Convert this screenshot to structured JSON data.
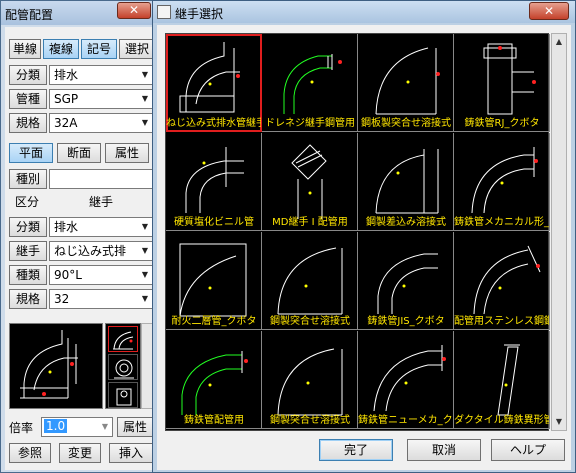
{
  "left_panel": {
    "title": "配管配置",
    "close": "✕",
    "mode_buttons": [
      "単線",
      "複線",
      "記号",
      "選択"
    ],
    "fields1": [
      {
        "label": "分類",
        "value": "排水"
      },
      {
        "label": "管種",
        "value": "SGP"
      },
      {
        "label": "規格",
        "value": "32A"
      }
    ],
    "view_buttons": [
      "平面",
      "断面",
      "属性"
    ],
    "kind_label": "種別",
    "kind_value": "",
    "section_label": "区分",
    "section_value": "継手",
    "fields2": [
      {
        "label": "分類",
        "value": "排水"
      },
      {
        "label": "継手",
        "value": "ねじ込み式排"
      },
      {
        "label": "種類",
        "value": "90°L"
      },
      {
        "label": "規格",
        "value": "32"
      }
    ],
    "scale_label": "倍率",
    "scale_value": "1.0",
    "attr_button": "属性",
    "bottom_buttons": [
      "参照",
      "変更",
      "挿入"
    ]
  },
  "dialog": {
    "title": "継手選択",
    "close": "✕",
    "items": [
      "ねじ込み式排水管継手",
      "ドレネジ継手鋼管用",
      "鋼板製突合せ溶接式",
      "鋳鉄管RJ_クボタ",
      "硬質塩化ビニル管",
      "MD継手 I 配管用",
      "鋼製差込み溶接式",
      "鋳鉄管メカニカル形_クボタ",
      "耐火二層管_クボタ",
      "鋼製突合せ溶接式",
      "鋳鉄管JIS_クボタ",
      "配管用ステンレス鋼鋼管",
      "鋳鉄管配管用",
      "鋼製突合せ溶接式",
      "鋳鉄管ニューメカ_クボタ",
      "ダクタイル鋳鉄異形管"
    ],
    "buttons": {
      "ok": "完了",
      "cancel": "取消",
      "help": "ヘルプ"
    }
  }
}
